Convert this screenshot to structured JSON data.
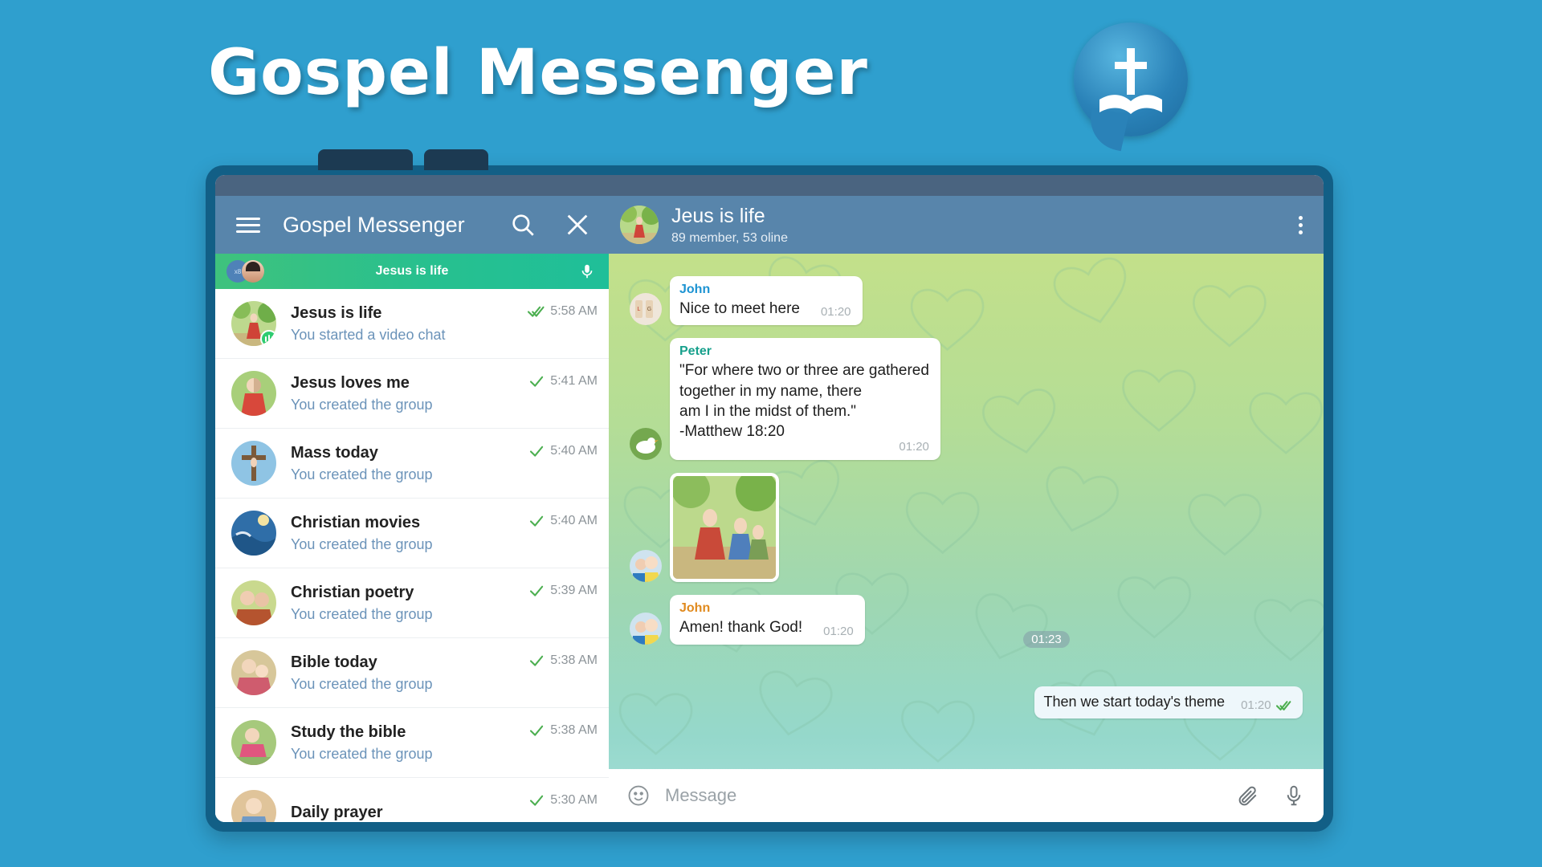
{
  "promo": {
    "title": "Gospel Messenger",
    "logo_icon": "cross-bible-logo",
    "background_color": "#2f9fce"
  },
  "appbar": {
    "menu_icon": "hamburger-menu-icon",
    "app_title": "Gospel Messenger",
    "search_icon": "search-icon",
    "close_icon": "close-icon",
    "more_icon": "more-vertical-icon",
    "chat_title": "Jeus is life",
    "chat_subtitle": "89 member, 53 oline",
    "background_color": "#5885ab"
  },
  "call_banner": {
    "title": "Jesus is life",
    "mic_icon": "microphone-icon",
    "accent_color": "#27c08f"
  },
  "chat_list": [
    {
      "title": "Jesus is life",
      "subtitle": "You started a video chat",
      "time": "5:58 AM",
      "ticks": 2,
      "live": true
    },
    {
      "title": "Jesus loves me",
      "subtitle": "You created the group",
      "time": "5:41 AM",
      "ticks": 1,
      "live": false
    },
    {
      "title": "Mass today",
      "subtitle": "You created the group",
      "time": "5:40 AM",
      "ticks": 1,
      "live": false
    },
    {
      "title": "Christian movies",
      "subtitle": "You created the group",
      "time": "5:40 AM",
      "ticks": 1,
      "live": false
    },
    {
      "title": "Christian poetry",
      "subtitle": "You created the group",
      "time": "5:39 AM",
      "ticks": 1,
      "live": false
    },
    {
      "title": "Bible today",
      "subtitle": "You created the group",
      "time": "5:38 AM",
      "ticks": 1,
      "live": false
    },
    {
      "title": "Study the bible",
      "subtitle": "You created the group",
      "time": "5:38 AM",
      "ticks": 1,
      "live": false
    },
    {
      "title": "Daily prayer",
      "subtitle": "",
      "time": "5:30 AM",
      "ticks": 1,
      "live": false
    }
  ],
  "messages": [
    {
      "sender": "John",
      "sender_color": "#1c93d2",
      "text": "Nice to meet here",
      "time": "01:20",
      "type": "text"
    },
    {
      "sender": "Peter",
      "sender_color": "#17a08c",
      "text": "\"For where two or three are gathered\ntogether in my name, there\nam I in the midst of them.\"\n-Matthew 18:20",
      "time": "01:20",
      "type": "text"
    },
    {
      "sender": "",
      "sender_color": "",
      "text": "",
      "time": "",
      "type": "photo"
    },
    {
      "sender": "John",
      "sender_color": "#e08a1e",
      "text": "Amen! thank God!",
      "time": "01:20",
      "type": "text"
    }
  ],
  "outgoing_message": {
    "text": "Then we start today's theme",
    "time": "01:20",
    "ticks": 2
  },
  "time_pill": "01:23",
  "composer": {
    "emoji_icon": "emoji-smiley-icon",
    "placeholder": "Message",
    "attach_icon": "paperclip-icon",
    "mic_icon": "microphone-icon"
  },
  "colors": {
    "tick_green": "#4caf50",
    "link_blue": "#6b93b9",
    "device_frame": "#125f86"
  }
}
